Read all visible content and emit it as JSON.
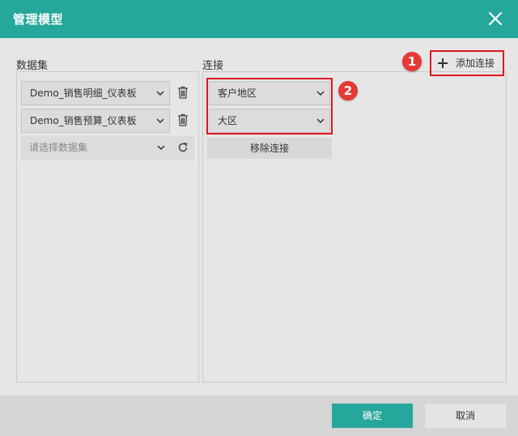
{
  "dialog": {
    "title": "管理模型",
    "close_icon": "close-icon"
  },
  "datasets": {
    "label": "数据集",
    "items": [
      {
        "value": "Demo_销售明细_仪表板",
        "delete_icon": "trash-icon"
      },
      {
        "value": "Demo_销售预算_仪表板",
        "delete_icon": "trash-icon"
      }
    ],
    "new_item": {
      "placeholder": "请选择数据集",
      "refresh_icon": "refresh-icon"
    }
  },
  "connection": {
    "label": "连接",
    "add_label": "添加连接",
    "add_icon": "plus-icon",
    "fields": [
      {
        "value": "客户地区"
      },
      {
        "value": "大区"
      }
    ],
    "remove_label": "移除连接"
  },
  "annotations": {
    "badge1": "1",
    "badge2": "2"
  },
  "footer": {
    "ok_label": "确定",
    "cancel_label": "取消"
  },
  "colors": {
    "header": "#26a79b",
    "accent": "#26a79b",
    "highlight": "#e0171f",
    "badge": "#e53935"
  }
}
